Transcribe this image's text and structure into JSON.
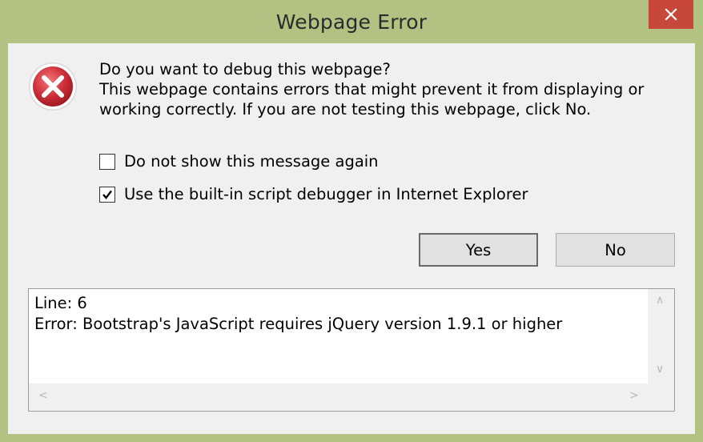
{
  "window": {
    "title": "Webpage Error"
  },
  "message": {
    "line1": "Do you want to debug this webpage?",
    "line2": "This webpage contains errors that might prevent it from displaying or",
    "line3": "working correctly. If you are not testing this webpage, click No."
  },
  "checkboxes": [
    {
      "label": "Do not show this message again",
      "checked": false
    },
    {
      "label": "Use the built-in script debugger in Internet Explorer",
      "checked": true
    }
  ],
  "buttons": {
    "yes": "Yes",
    "no": "No"
  },
  "details": {
    "line1": "Line: 6",
    "line2": "Error: Bootstrap's JavaScript requires jQuery version 1.9.1 or higher"
  },
  "icons": {
    "error": "error-x-icon",
    "close": "close-icon",
    "check": "checkmark-icon"
  },
  "colors": {
    "frame": "#b3c283",
    "close_button": "#c7483b",
    "error_icon": "#c0282b",
    "dialog_bg": "#f0f0f0"
  }
}
